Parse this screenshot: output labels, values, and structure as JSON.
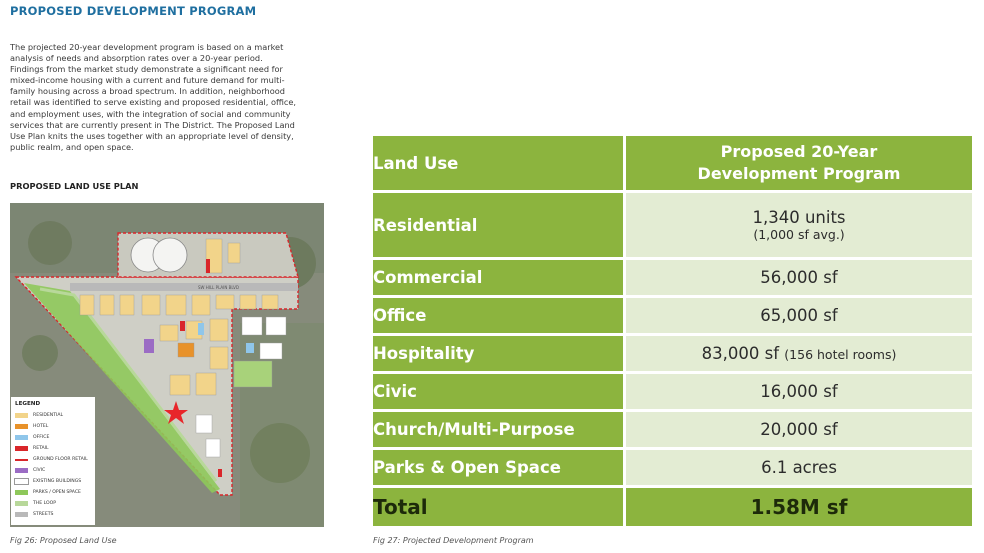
{
  "page": {
    "title": "PROPOSED DEVELOPMENT PROGRAM",
    "paragraph_lines": [
      "The projected 20-year development program is based on a market",
      "analysis of needs and absorption rates over a 20-year period.",
      "Findings from the market study demonstrate a significant need for",
      "mixed-income housing with a current and future demand for multi-",
      "family housing across a broad spectrum. In addition, neighborhood",
      "retail was identified to serve existing and proposed residential, office,",
      "and employment uses, with the integration of social and community",
      "services that are currently present in The District. The Proposed Land",
      "Use Plan knits the uses together with an appropriate level of density,",
      "public realm, and open space."
    ],
    "plan_title": "PROPOSED LAND USE PLAN",
    "fig26_caption": "Fig 26: Proposed Land Use",
    "fig27_caption": "Fig 27: Projected Development Program"
  },
  "map": {
    "street_label": "SW HILL PLAIN BLVD",
    "legend_title": "LEGEND",
    "legend": [
      {
        "label": "RESIDENTIAL",
        "color": "#f2d48a"
      },
      {
        "label": "HOTEL",
        "color": "#e8922a"
      },
      {
        "label": "OFFICE",
        "color": "#8fc6ea"
      },
      {
        "label": "RETAIL",
        "color": "#d9262a"
      },
      {
        "label": "GROUND FLOOR RETAIL",
        "color": "#d9262a"
      },
      {
        "label": "CIVIC",
        "color": "#9b6cc4"
      },
      {
        "label": "EXISTING BUILDINGS",
        "color": "#ffffff"
      },
      {
        "label": "PARKS / OPEN SPACE",
        "color": "#8ec85a"
      },
      {
        "label": "THE LOOP",
        "color": "#b8d89a"
      },
      {
        "label": "STREETS",
        "color": "#b9b9b9"
      }
    ]
  },
  "table": {
    "header": {
      "use": "Land Use",
      "value_line1": "Proposed 20-Year",
      "value_line2": "Development Program"
    },
    "rows": [
      {
        "use": "Residential",
        "value": "1,340 units",
        "sub": "(1,000 sf avg.)"
      },
      {
        "use": "Commercial",
        "value": "56,000 sf",
        "sub": ""
      },
      {
        "use": "Office",
        "value": "65,000 sf",
        "sub": ""
      },
      {
        "use": "Hospitality",
        "value": "83,000 sf",
        "sub": "(156 hotel rooms)"
      },
      {
        "use": "Civic",
        "value": "16,000 sf",
        "sub": ""
      },
      {
        "use": "Church/Multi-Purpose",
        "value": "20,000 sf",
        "sub": ""
      },
      {
        "use": "Parks & Open Space",
        "value": "6.1 acres",
        "sub": ""
      }
    ],
    "total": {
      "use": "Total",
      "value": "1.58M sf"
    },
    "colors": {
      "header_green": "#8cb43e",
      "row_bg": "#e3ecd3"
    }
  }
}
